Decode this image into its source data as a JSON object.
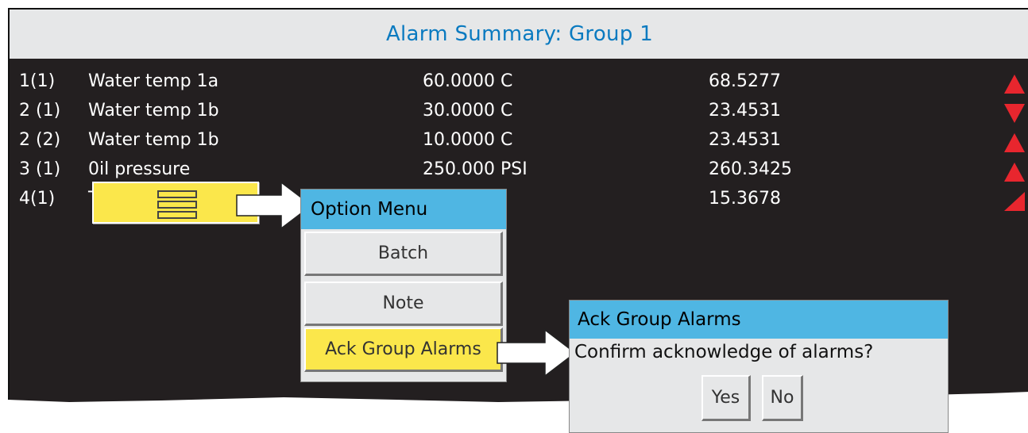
{
  "title": "Alarm Summary: Group 1",
  "colors": {
    "accent": "#0a7ac0",
    "header_blue": "#4fb6e3",
    "highlight": "#fbe74b",
    "alarm_red": "#e8262e"
  },
  "alarms": [
    {
      "index": "1(1)",
      "name": "Water temp 1a",
      "threshold": "60.0000 C",
      "value": "68.5277",
      "indicator": "up"
    },
    {
      "index": "2 (1)",
      "name": "Water temp 1b",
      "threshold": "30.0000 C",
      "value": "23.4531",
      "indicator": "down"
    },
    {
      "index": "2 (2)",
      "name": "Water temp 1b",
      "threshold": "10.0000 C",
      "value": "23.4531",
      "indicator": "up"
    },
    {
      "index": "3 (1)",
      "name": "0il pressure",
      "threshold": "250.000 PSI",
      "value": "260.3425",
      "indicator": "up"
    },
    {
      "index": "4(1)",
      "name": "T",
      "threshold": "",
      "value": "15.3678",
      "indicator": "ramp"
    }
  ],
  "option_menu": {
    "title": "Option Menu",
    "items": [
      "Batch",
      "Note",
      "Ack Group Alarms"
    ],
    "selected": "Ack Group Alarms"
  },
  "dialog": {
    "title": "Ack Group Alarms",
    "message": "Confirm acknowledge of alarms?",
    "yes_label": "Yes",
    "no_label": "No"
  }
}
